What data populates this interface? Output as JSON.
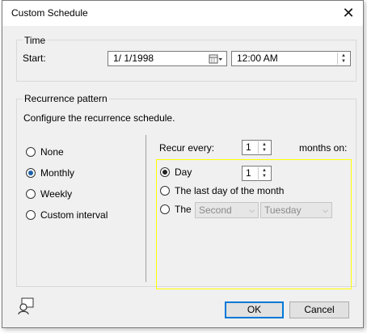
{
  "window": {
    "title": "Custom Schedule",
    "close_glyph": "✕"
  },
  "time": {
    "group_label": "Time",
    "start_label": "Start:",
    "date_value": "1/  1/1998",
    "time_value": "12:00 AM"
  },
  "recurrence": {
    "group_label": "Recurrence pattern",
    "description": "Configure the recurrence schedule.",
    "options": [
      {
        "label": "None",
        "checked": false
      },
      {
        "label": "Monthly",
        "checked": true
      },
      {
        "label": "Weekly",
        "checked": false
      },
      {
        "label": "Custom interval",
        "checked": false
      }
    ],
    "recur_every_label": "Recur every:",
    "recur_every_value": "1",
    "months_on_label": "months on:",
    "day_label": "Day",
    "day_value": "1",
    "last_day_label": "The last day of the month",
    "the_label": "The",
    "ordinal_value": "Second",
    "weekday_value": "Tuesday",
    "highlight_color": "#ffff00"
  },
  "buttons": {
    "ok": "OK",
    "cancel": "Cancel"
  },
  "icons": {
    "calendar": "calendar-dropdown-icon",
    "help": "context-help-icon"
  },
  "colors": {
    "accent": "#0078d7",
    "radio_selected": "#1c5fa8"
  }
}
